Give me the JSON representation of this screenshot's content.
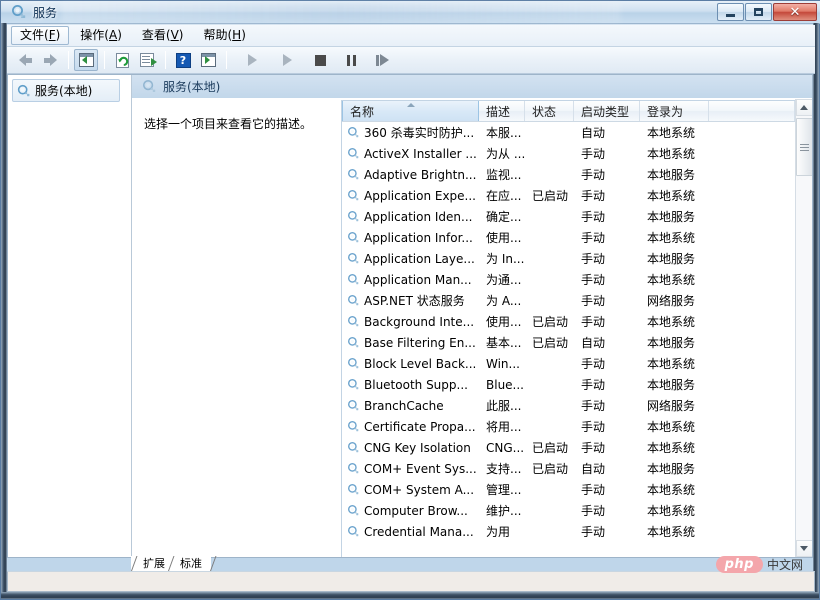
{
  "window": {
    "title": "服务",
    "title_icon": "services-gear-icon",
    "buttons": {
      "minimize": "最小化",
      "maximize": "最大化",
      "close": "关闭"
    }
  },
  "menubar": {
    "items": [
      {
        "label": "文件(F)",
        "text": "文件(",
        "accel": "F",
        "tail": ")",
        "name": "menu-file",
        "focused": true
      },
      {
        "label": "操作(A)",
        "text": "操作(",
        "accel": "A",
        "tail": ")",
        "name": "menu-action",
        "focused": false
      },
      {
        "label": "查看(V)",
        "text": "查看(",
        "accel": "V",
        "tail": ")",
        "name": "menu-view",
        "focused": false
      },
      {
        "label": "帮助(H)",
        "text": "帮助(",
        "accel": "H",
        "tail": ")",
        "name": "menu-help",
        "focused": false
      }
    ]
  },
  "toolbar": {
    "buttons": [
      {
        "name": "back-icon",
        "title": "后退"
      },
      {
        "name": "forward-icon",
        "title": "前进"
      },
      {
        "name": "show-hide-tree-icon",
        "title": "显示/隐藏控制台树"
      },
      {
        "name": "refresh-icon",
        "title": "刷新"
      },
      {
        "name": "export-list-icon",
        "title": "导出列表"
      },
      {
        "name": "help-icon",
        "title": "帮助"
      },
      {
        "name": "properties-icon",
        "title": "属性"
      },
      {
        "name": "start-service-icon",
        "title": "启动服务"
      },
      {
        "name": "resume-service-icon",
        "title": "恢复服务"
      },
      {
        "name": "stop-service-icon",
        "title": "停止服务"
      },
      {
        "name": "pause-service-icon",
        "title": "暂停服务"
      },
      {
        "name": "restart-service-icon",
        "title": "重启服务"
      }
    ]
  },
  "tree": {
    "root": {
      "label": "服务(本地)",
      "icon": "services-gear-icon"
    }
  },
  "pane": {
    "header": "服务(本地)",
    "description_placeholder": "选择一个项目来查看它的描述。"
  },
  "list": {
    "columns": [
      {
        "key": "name",
        "label": "名称",
        "width": 137,
        "sorted": true,
        "sort_dir": "asc"
      },
      {
        "key": "desc",
        "label": "描述",
        "width": 46,
        "sorted": false
      },
      {
        "key": "status",
        "label": "状态",
        "width": 49,
        "sorted": false
      },
      {
        "key": "startup",
        "label": "启动类型",
        "width": 66,
        "sorted": false
      },
      {
        "key": "logon",
        "label": "登录为",
        "width": 69,
        "sorted": false
      },
      {
        "key": "spacer",
        "label": "",
        "width": 87,
        "sorted": false
      }
    ],
    "rows": [
      {
        "name": "360 杀毒实时防护...",
        "desc": "本服...",
        "status": "",
        "startup": "自动",
        "logon": "本地系统"
      },
      {
        "name": "ActiveX Installer ...",
        "desc": "为从 ...",
        "status": "",
        "startup": "手动",
        "logon": "本地系统"
      },
      {
        "name": "Adaptive Brightn...",
        "desc": "监视...",
        "status": "",
        "startup": "手动",
        "logon": "本地服务"
      },
      {
        "name": "Application Expe...",
        "desc": "在应...",
        "status": "已启动",
        "startup": "手动",
        "logon": "本地系统"
      },
      {
        "name": "Application Iden...",
        "desc": "确定...",
        "status": "",
        "startup": "手动",
        "logon": "本地服务"
      },
      {
        "name": "Application Infor...",
        "desc": "使用...",
        "status": "",
        "startup": "手动",
        "logon": "本地系统"
      },
      {
        "name": "Application Laye...",
        "desc": "为 In...",
        "status": "",
        "startup": "手动",
        "logon": "本地服务"
      },
      {
        "name": "Application Man...",
        "desc": "为通...",
        "status": "",
        "startup": "手动",
        "logon": "本地系统"
      },
      {
        "name": "ASP.NET 状态服务",
        "desc": "为 A...",
        "status": "",
        "startup": "手动",
        "logon": "网络服务"
      },
      {
        "name": "Background Inte...",
        "desc": "使用...",
        "status": "已启动",
        "startup": "手动",
        "logon": "本地系统"
      },
      {
        "name": "Base Filtering En...",
        "desc": "基本...",
        "status": "已启动",
        "startup": "自动",
        "logon": "本地服务"
      },
      {
        "name": "Block Level Back...",
        "desc": "Win...",
        "status": "",
        "startup": "手动",
        "logon": "本地系统"
      },
      {
        "name": "Bluetooth Supp...",
        "desc": "Blue...",
        "status": "",
        "startup": "手动",
        "logon": "本地服务"
      },
      {
        "name": "BranchCache",
        "desc": "此服...",
        "status": "",
        "startup": "手动",
        "logon": "网络服务"
      },
      {
        "name": "Certificate Propa...",
        "desc": "将用...",
        "status": "",
        "startup": "手动",
        "logon": "本地系统"
      },
      {
        "name": "CNG Key Isolation",
        "desc": "CNG...",
        "status": "已启动",
        "startup": "手动",
        "logon": "本地系统"
      },
      {
        "name": "COM+ Event Sys...",
        "desc": "支持...",
        "status": "已启动",
        "startup": "自动",
        "logon": "本地服务"
      },
      {
        "name": "COM+ System A...",
        "desc": "管理...",
        "status": "",
        "startup": "手动",
        "logon": "本地系统"
      },
      {
        "name": "Computer Brow...",
        "desc": "维护...",
        "status": "",
        "startup": "手动",
        "logon": "本地系统"
      },
      {
        "name": "Credential Mana...",
        "desc": "为用",
        "status": "",
        "startup": "手动",
        "logon": "本地系统"
      }
    ],
    "scrollbar": {
      "up_label": "向上滚动",
      "down_label": "向下滚动",
      "thumb_label": "滚动滑块"
    }
  },
  "tabs": [
    {
      "label": "扩展",
      "name": "tab-extended",
      "selected": false
    },
    {
      "label": "标准",
      "name": "tab-standard",
      "selected": true
    }
  ],
  "statusbar": {
    "text": ""
  },
  "watermark": {
    "badge": "php",
    "text": "中文网"
  },
  "colors": {
    "accent": "#1559b3",
    "header_banner": "#c2d7ea",
    "sorted_column": "#d9e9f7",
    "close_button": "#c4483a",
    "gear_blue": "#5f9ec9",
    "watermark_pink": "#f4a6ab"
  }
}
